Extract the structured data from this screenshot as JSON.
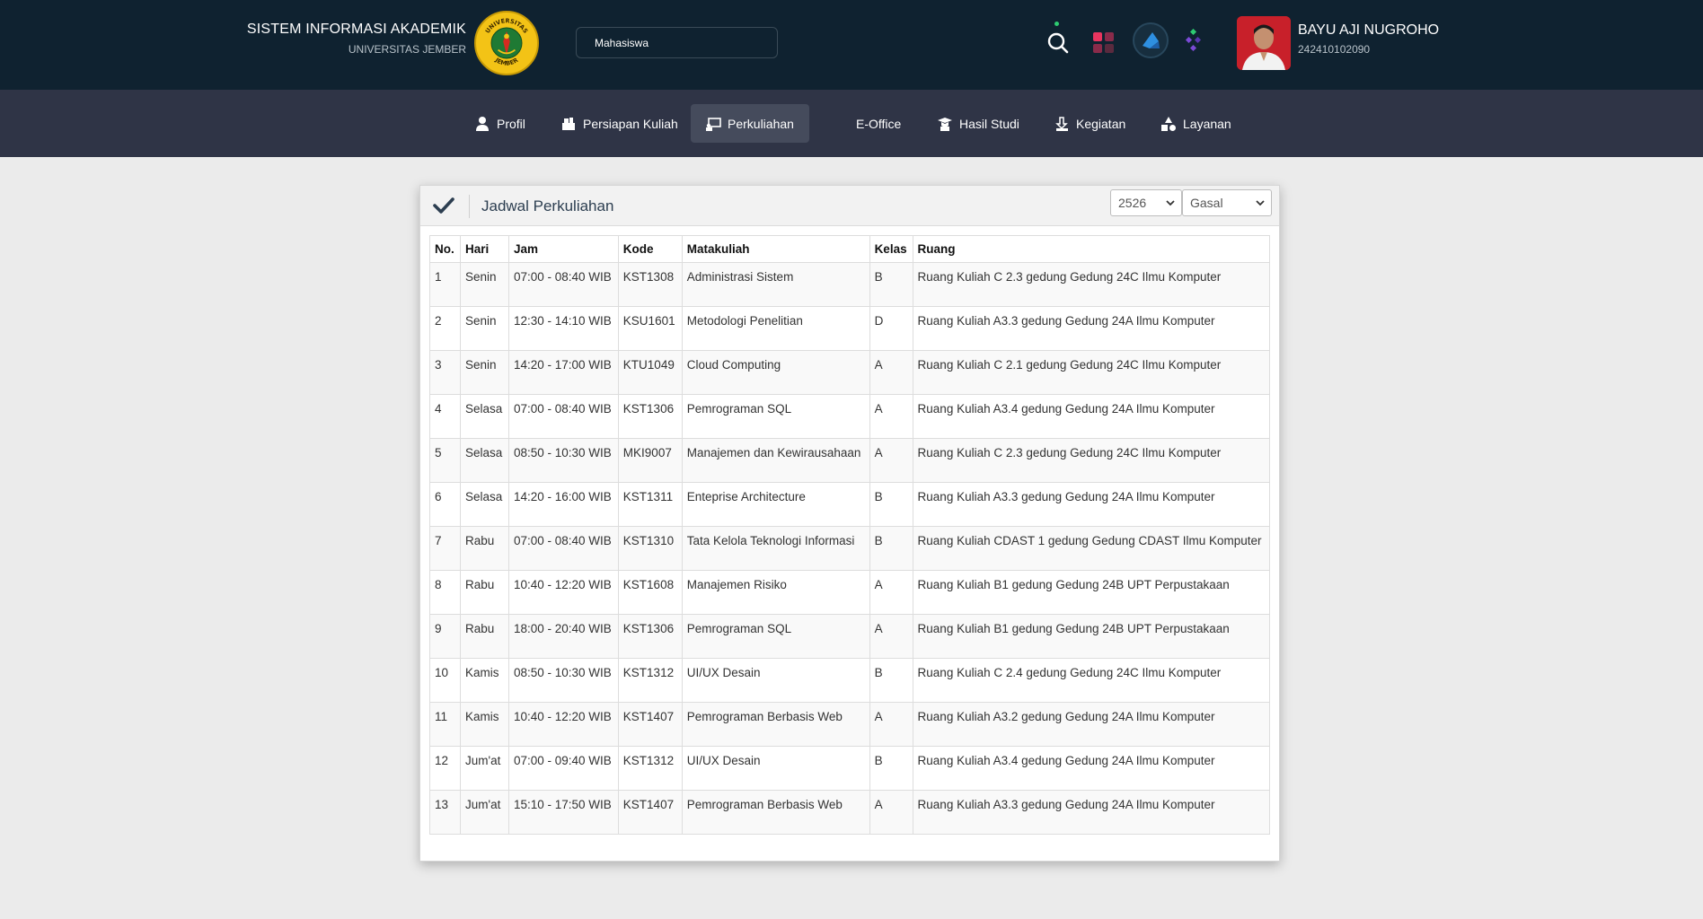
{
  "header": {
    "app_title": "SISTEM INFORMASI AKADEMIK",
    "institution": "UNIVERSITAS JEMBER",
    "logo_text_top": "UNIVERSITAS",
    "logo_text_bottom": "JEMBER",
    "role": "Mahasiswa",
    "icons": [
      "search-icon",
      "apps-grid-icon",
      "launch-icon",
      "diamond-dots-icon"
    ],
    "user": {
      "name": "BAYU AJI NUGROHO",
      "nim": "242410102090"
    }
  },
  "nav": {
    "items": [
      {
        "label": "Profil",
        "icon": "user-icon",
        "active": false
      },
      {
        "label": "Persiapan Kuliah",
        "icon": "books-icon",
        "active": false
      },
      {
        "label": "Perkuliahan",
        "icon": "classroom-icon",
        "active": true
      },
      {
        "label": "E-Office",
        "icon": "",
        "active": false
      },
      {
        "label": "Hasil Studi",
        "icon": "graduate-icon",
        "active": false
      },
      {
        "label": "Kegiatan",
        "icon": "activity-icon",
        "active": false
      },
      {
        "label": "Layanan",
        "icon": "shapes-icon",
        "active": false
      }
    ]
  },
  "panel": {
    "title": "Jadwal Perkuliahan",
    "year_select": "2526",
    "semester_select": "Gasal"
  },
  "table": {
    "columns": [
      "No.",
      "Hari",
      "Jam",
      "Kode",
      "Matakuliah",
      "Kelas",
      "Ruang"
    ],
    "rows": [
      [
        "1",
        "Senin",
        "07:00 - 08:40 WIB",
        "KST1308",
        "Administrasi Sistem",
        "B",
        "Ruang Kuliah C 2.3 gedung Gedung 24C Ilmu Komputer"
      ],
      [
        "2",
        "Senin",
        "12:30 - 14:10 WIB",
        "KSU1601",
        "Metodologi Penelitian",
        "D",
        "Ruang Kuliah A3.3 gedung Gedung 24A Ilmu Komputer"
      ],
      [
        "3",
        "Senin",
        "14:20 - 17:00 WIB",
        "KTU1049",
        "Cloud Computing",
        "A",
        "Ruang Kuliah C 2.1 gedung Gedung 24C Ilmu Komputer"
      ],
      [
        "4",
        "Selasa",
        "07:00 - 08:40 WIB",
        "KST1306",
        "Pemrograman SQL",
        "A",
        "Ruang Kuliah A3.4 gedung Gedung 24A Ilmu Komputer"
      ],
      [
        "5",
        "Selasa",
        "08:50 - 10:30 WIB",
        "MKI9007",
        "Manajemen dan Kewirausahaan",
        "A",
        "Ruang Kuliah C 2.3 gedung Gedung 24C Ilmu Komputer"
      ],
      [
        "6",
        "Selasa",
        "14:20 - 16:00 WIB",
        "KST1311",
        "Enteprise Architecture",
        "B",
        "Ruang Kuliah A3.3 gedung Gedung 24A Ilmu Komputer"
      ],
      [
        "7",
        "Rabu",
        "07:00 - 08:40 WIB",
        "KST1310",
        "Tata Kelola Teknologi Informasi",
        "B",
        "Ruang Kuliah CDAST 1 gedung Gedung CDAST Ilmu Komputer"
      ],
      [
        "8",
        "Rabu",
        "10:40 - 12:20 WIB",
        "KST1608",
        "Manajemen Risiko",
        "A",
        "Ruang Kuliah B1 gedung Gedung 24B UPT Perpustakaan"
      ],
      [
        "9",
        "Rabu",
        "18:00 - 20:40 WIB",
        "KST1306",
        "Pemrograman SQL",
        "A",
        "Ruang Kuliah B1 gedung Gedung 24B UPT Perpustakaan"
      ],
      [
        "10",
        "Kamis",
        "08:50 - 10:30 WIB",
        "KST1312",
        "UI/UX Desain",
        "B",
        "Ruang Kuliah C 2.4 gedung Gedung 24C Ilmu Komputer"
      ],
      [
        "11",
        "Kamis",
        "10:40 - 12:20 WIB",
        "KST1407",
        "Pemrograman Berbasis Web",
        "A",
        "Ruang Kuliah A3.2 gedung Gedung 24A Ilmu Komputer"
      ],
      [
        "12",
        "Jum'at",
        "07:00 - 09:40 WIB",
        "KST1312",
        "UI/UX Desain",
        "B",
        "Ruang Kuliah A3.4 gedung Gedung 24A Ilmu Komputer"
      ],
      [
        "13",
        "Jum'at",
        "15:10 - 17:50 WIB",
        "KST1407",
        "Pemrograman Berbasis Web",
        "A",
        "Ruang Kuliah A3.3 gedung Gedung 24A Ilmu Komputer"
      ]
    ]
  },
  "colors": {
    "header_bg": "#0f2230",
    "nav_bg": "#2f3446",
    "nav_active_bg": "#454b5c",
    "page_bg": "#ebebeb",
    "check_color": "#2c3e50"
  }
}
